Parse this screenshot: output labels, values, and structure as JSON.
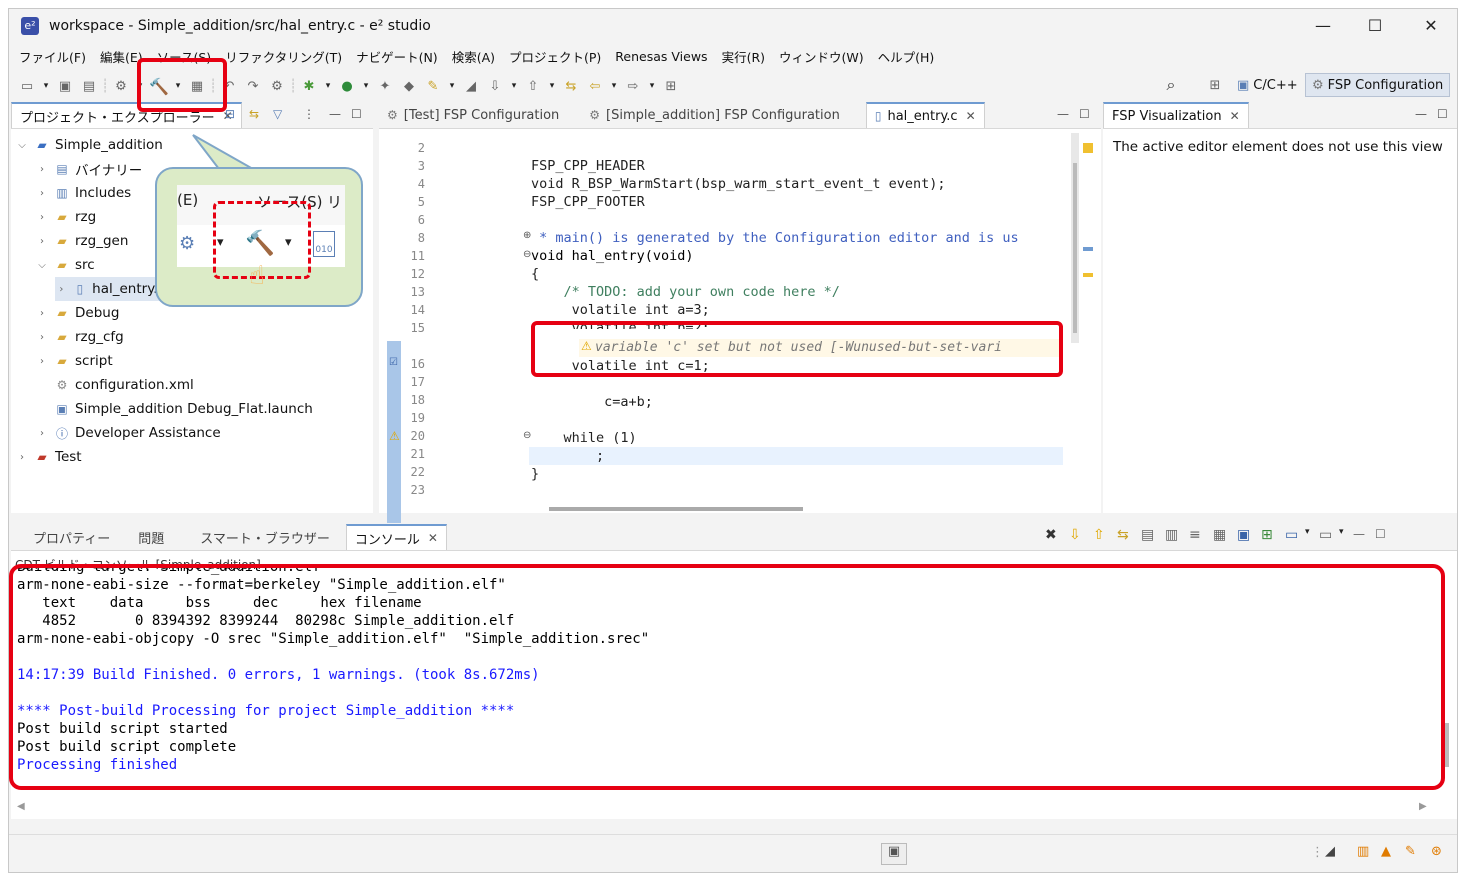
{
  "window": {
    "title": "workspace - Simple_addition/src/hal_entry.c - e² studio",
    "controls": {
      "minimize": "—",
      "maximize": "☐",
      "close": "✕"
    }
  },
  "menu": [
    "ファイル(F)",
    "編集(E)",
    "ソース(S)",
    "リファクタリング(T)",
    "ナビゲート(N)",
    "検索(A)",
    "プロジェクト(P)",
    "Renesas Views",
    "実行(R)",
    "ウィンドウ(W)",
    "ヘルプ(H)"
  ],
  "perspectives": {
    "cpp": "C/C++",
    "fsp": "FSP Configuration"
  },
  "explorer": {
    "tab_label": "プロジェクト・エクスプローラー",
    "tree": [
      {
        "label": "Simple_addition",
        "icon": "project-icon",
        "twisty": "⌵"
      },
      {
        "label": "バイナリー",
        "icon": "binaries-icon",
        "twisty": "›"
      },
      {
        "label": "Includes",
        "icon": "includes-icon",
        "twisty": "›"
      },
      {
        "label": "rzg",
        "icon": "folder-icon",
        "twisty": "›"
      },
      {
        "label": "rzg_gen",
        "icon": "folder-icon",
        "twisty": "›"
      },
      {
        "label": "src",
        "icon": "folder-icon",
        "twisty": "⌵"
      },
      {
        "label": "hal_entry.c",
        "icon": "c-file-icon",
        "twisty": "›"
      },
      {
        "label": "Debug",
        "icon": "folder-icon",
        "twisty": "›"
      },
      {
        "label": "rzg_cfg",
        "icon": "folder-icon",
        "twisty": "›"
      },
      {
        "label": "script",
        "icon": "folder-icon",
        "twisty": "›"
      },
      {
        "label": "configuration.xml",
        "icon": "gear-icon",
        "twisty": ""
      },
      {
        "label": "Simple_addition Debug_Flat.launch",
        "icon": "launch-icon",
        "twisty": ""
      },
      {
        "label": "Developer Assistance",
        "icon": "help-icon",
        "twisty": "›"
      },
      {
        "label": "Test",
        "icon": "project-icon",
        "twisty": "›"
      }
    ]
  },
  "callout": {
    "menu_e": "(E)",
    "menu_s": "ソース(S)",
    "menu_r": "リ"
  },
  "editor": {
    "tabs": [
      "[Test] FSP Configuration",
      "[Simple_addition] FSP Configuration",
      "hal_entry.c"
    ],
    "lines": [
      {
        "n": "2",
        "text": ""
      },
      {
        "n": "3",
        "text": "FSP_CPP_HEADER"
      },
      {
        "n": "4",
        "text": "void R_BSP_WarmStart(bsp_warm_start_event_t event);"
      },
      {
        "n": "5",
        "text": "FSP_CPP_FOOTER"
      },
      {
        "n": "6",
        "text": ""
      },
      {
        "n": "8",
        "text": " * main() is generated by the Configuration editor and is us"
      },
      {
        "n": "11",
        "text": "void hal_entry(void)"
      },
      {
        "n": "12",
        "text": "{"
      },
      {
        "n": "13",
        "text": "    /* TODO: add your own code here */"
      },
      {
        "n": "14",
        "text": "     volatile int a=3;"
      },
      {
        "n": "15",
        "text": "     volatile int b=2;"
      },
      {
        "n": "16",
        "text": "     volatile int c=1;"
      },
      {
        "n": "17",
        "text": ""
      },
      {
        "n": "18",
        "text": "         c=a+b;"
      },
      {
        "n": "19",
        "text": ""
      },
      {
        "n": "20",
        "text": "    while (1)"
      },
      {
        "n": "21",
        "text": "        ;"
      },
      {
        "n": "22",
        "text": "}"
      },
      {
        "n": "23",
        "text": ""
      }
    ],
    "warning": "variable 'c' set but not used [-Wunused-but-set-vari"
  },
  "fsp_view": {
    "tab_label": "FSP Visualization",
    "message": "The active editor element does not use this view"
  },
  "bottom": {
    "tabs": [
      "プロパティー",
      "問題",
      "スマート・ブラウザー",
      "コンソール"
    ],
    "console_title": "CDT ビルド・コンソール [Simple_addition]",
    "lines": [
      {
        "text": "Building target: Simple_addition.elf",
        "style": "black"
      },
      {
        "text": "arm-none-eabi-size --format=berkeley \"Simple_addition.elf\"",
        "style": "black"
      },
      {
        "text": "   text    data     bss     dec     hex filename",
        "style": "black"
      },
      {
        "text": "   4852       0 8394392 8399244  80298c Simple_addition.elf",
        "style": "black"
      },
      {
        "text": "arm-none-eabi-objcopy -O srec \"Simple_addition.elf\"  \"Simple_addition.srec\"",
        "style": "black"
      },
      {
        "text": "",
        "style": "black"
      },
      {
        "text": "14:17:39 Build Finished. 0 errors, 1 warnings. (took 8s.672ms)",
        "style": "blue"
      },
      {
        "text": "",
        "style": "black"
      },
      {
        "text": "**** Post-build Processing for project Simple_addition ****",
        "style": "blue"
      },
      {
        "text": "Post build script started",
        "style": "black"
      },
      {
        "text": "Post build script complete",
        "style": "black"
      },
      {
        "text": "Processing finished",
        "style": "blue"
      }
    ]
  },
  "colors": {
    "highlight": "#e60012",
    "callout_bg": "#dcebc7",
    "console_blue": "#1a1aff"
  }
}
